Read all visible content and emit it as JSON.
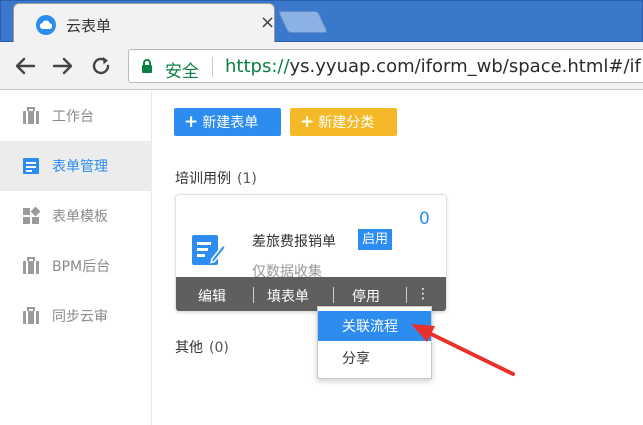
{
  "browser": {
    "tab_title": "云表单",
    "tab_close": "×",
    "secure_label": "安全",
    "url_scheme": "https://",
    "url_rest": "ys.yyuap.com/iform_wb/space.html#/if"
  },
  "sidebar": {
    "items": [
      {
        "label": "工作台",
        "icon": "briefcase-icon",
        "active": false
      },
      {
        "label": "表单管理",
        "icon": "form-list-icon",
        "active": true
      },
      {
        "label": "表单模板",
        "icon": "template-grid-icon",
        "active": false
      },
      {
        "label": "BPM后台",
        "icon": "briefcase-icon",
        "active": false
      },
      {
        "label": "同步云审",
        "icon": "briefcase-icon",
        "active": false
      }
    ]
  },
  "actions": {
    "new_form": "新建表单",
    "new_category": "新建分类",
    "plus": "+"
  },
  "groups": [
    {
      "title": "培训用例",
      "count": "(1)"
    },
    {
      "title": "其他",
      "count": "(0)"
    }
  ],
  "card": {
    "name": "差旅费报销单",
    "status": "启用",
    "count": "0",
    "subtitle": "仅数据收集",
    "actions": [
      "编辑",
      "填表单",
      "停用"
    ],
    "more": "⋮"
  },
  "context_menu": {
    "items": [
      "关联流程",
      "分享"
    ]
  },
  "colors": {
    "primary": "#2d8cf0",
    "warning": "#f5b828",
    "secure_green": "#0b8043",
    "arrow_red": "#e8312a"
  }
}
